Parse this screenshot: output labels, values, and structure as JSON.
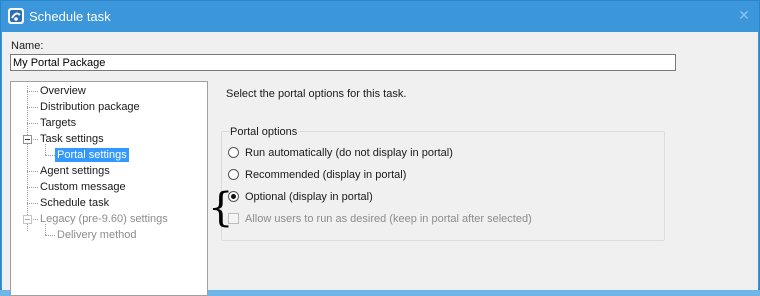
{
  "window": {
    "title": "Schedule task",
    "app_icon": "scheduler-app-icon",
    "close_icon": "close-icon"
  },
  "name_field": {
    "label": "Name:",
    "value": "My Portal Package"
  },
  "tree": {
    "items": [
      {
        "label": "Overview"
      },
      {
        "label": "Distribution package"
      },
      {
        "label": "Targets"
      },
      {
        "label": "Task settings",
        "expanded": true
      },
      {
        "label": "Portal settings",
        "selected": true
      },
      {
        "label": "Agent settings"
      },
      {
        "label": "Custom message"
      },
      {
        "label": "Schedule task"
      },
      {
        "label": "Legacy (pre-9.60) settings",
        "disabled": true,
        "expanded": true
      },
      {
        "label": "Delivery method",
        "disabled": true
      }
    ]
  },
  "main": {
    "instructions": "Select the portal options for this task.",
    "group_title": "Portal options",
    "options": [
      {
        "label": "Run automatically (do not display in portal)",
        "checked": false
      },
      {
        "label": "Recommended (display in portal)",
        "checked": false
      },
      {
        "label": "Optional (display in portal)",
        "checked": true
      }
    ],
    "allow_checkbox": {
      "label": "Allow users to run as desired (keep in portal after selected)",
      "checked": false,
      "enabled": false
    },
    "annotation_brace": "{"
  }
}
